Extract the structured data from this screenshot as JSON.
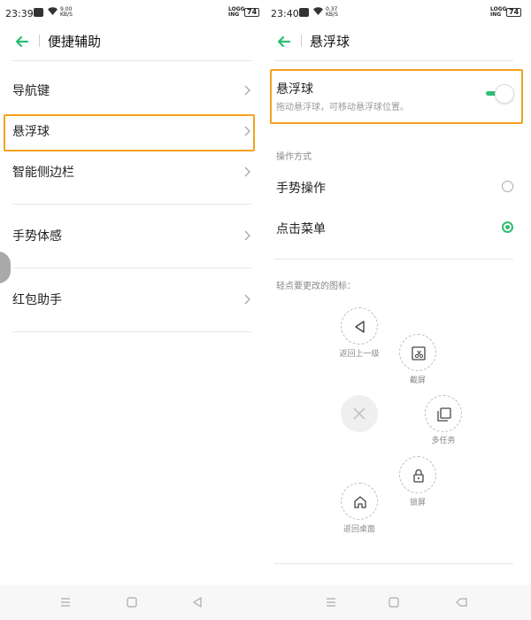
{
  "colors": {
    "accent": "#2ebd73",
    "highlight": "#f4a21e"
  },
  "left": {
    "status": {
      "time": "23:39",
      "speed_value": "9.00",
      "speed_unit": "KB/S",
      "logging_1": "LOGG",
      "logging_2": "ING",
      "battery": "74"
    },
    "header": {
      "back_icon": "back-arrow-icon",
      "title": "便捷辅助"
    },
    "items": [
      {
        "label": "导航键"
      },
      {
        "label": "悬浮球"
      },
      {
        "label": "智能侧边栏"
      },
      {
        "label": "手势体感"
      },
      {
        "label": "红包助手"
      }
    ],
    "nav": {
      "menu_icon": "menu-icon",
      "home_icon": "home-square-icon",
      "back_icon": "back-triangle-icon"
    }
  },
  "right": {
    "status": {
      "time": "23:40",
      "speed_value": "0.37",
      "speed_unit": "KB/S",
      "logging_1": "LOGG",
      "logging_2": "ING",
      "battery": "74"
    },
    "header": {
      "back_icon": "back-arrow-icon",
      "title": "悬浮球"
    },
    "floating_ball": {
      "title": "悬浮球",
      "subtitle": "拖动悬浮球，可移动悬浮球位置。",
      "enabled": true
    },
    "operation": {
      "section_label": "操作方式",
      "options": [
        {
          "label": "手势操作",
          "selected": false
        },
        {
          "label": "点击菜单",
          "selected": true
        }
      ]
    },
    "icons_section": {
      "label": "轻点要更改的图标：",
      "icons": [
        {
          "name": "back-triangle-icon",
          "caption": "返回上一级"
        },
        {
          "name": "screenshot-scissors-icon",
          "caption": "截屏"
        },
        {
          "name": "multitask-icon",
          "caption": "多任务"
        },
        {
          "name": "lock-icon",
          "caption": "锁屏"
        },
        {
          "name": "home-icon",
          "caption": "返回桌面"
        }
      ],
      "center_icon": "close-x-icon"
    },
    "nav": {
      "menu_icon": "menu-icon",
      "home_icon": "home-square-icon",
      "back_icon": "back-icon"
    }
  }
}
